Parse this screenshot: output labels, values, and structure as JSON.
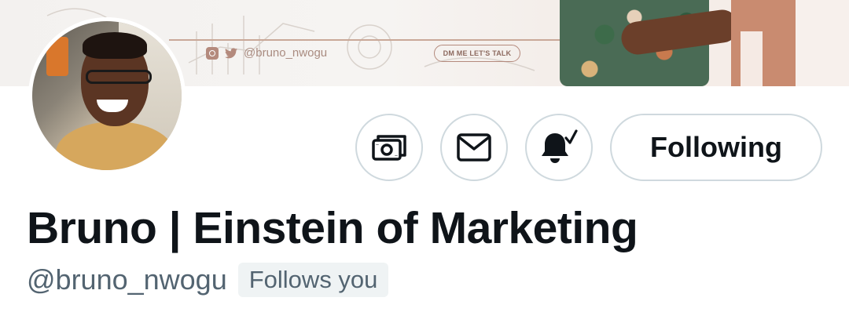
{
  "banner": {
    "social_handle": "@bruno_nwogu",
    "cta_label": "DM ME LET'S TALK"
  },
  "profile": {
    "display_name": "Bruno | Einstein of Marketing",
    "handle": "@bruno_nwogu",
    "follows_you_label": "Follows you"
  },
  "actions": {
    "tip_icon": "money-icon",
    "message_icon": "envelope-icon",
    "notify_icon": "bell-check-icon",
    "following_label": "Following"
  },
  "colors": {
    "text_primary": "#0f1419",
    "text_secondary": "#536471",
    "button_border": "#cfd9de",
    "badge_bg": "#eff3f4",
    "banner_accent": "#c98b70"
  }
}
